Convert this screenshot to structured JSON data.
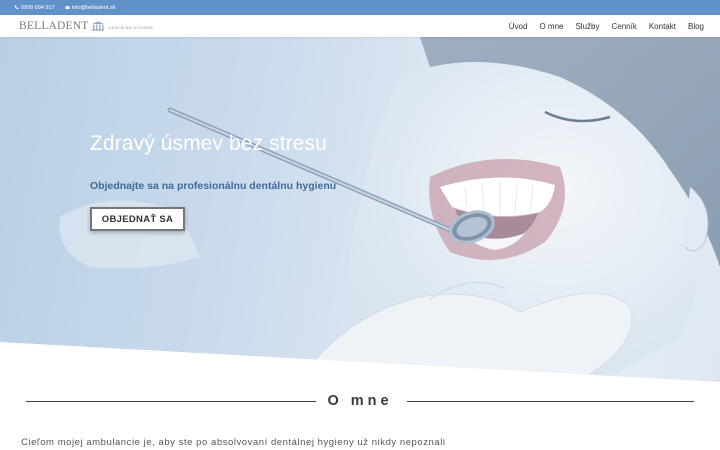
{
  "topbar": {
    "phone": "0908 684 917",
    "email": "info@belladent.sk"
  },
  "header": {
    "logo_name": "BELLADENT",
    "logo_tagline": "DENTÁLNA HYGIENA",
    "nav": [
      "Úvod",
      "O mne",
      "Služby",
      "Cenník",
      "Kontakt",
      "Blog"
    ]
  },
  "hero": {
    "title": "Zdravý úsmev bez stresu",
    "subtitle": "Objednajte sa na profesionálnu dentálnu hygienu",
    "button": "OBJEDNAŤ SA"
  },
  "about": {
    "title": "O mne",
    "text": "Cieľom mojej ambulancie je, aby ste po absolvovaní dentálnej hygieny už nikdy nepoznali"
  },
  "colors": {
    "accent": "#5f92c8",
    "subtitle": "#3f6a9a"
  }
}
